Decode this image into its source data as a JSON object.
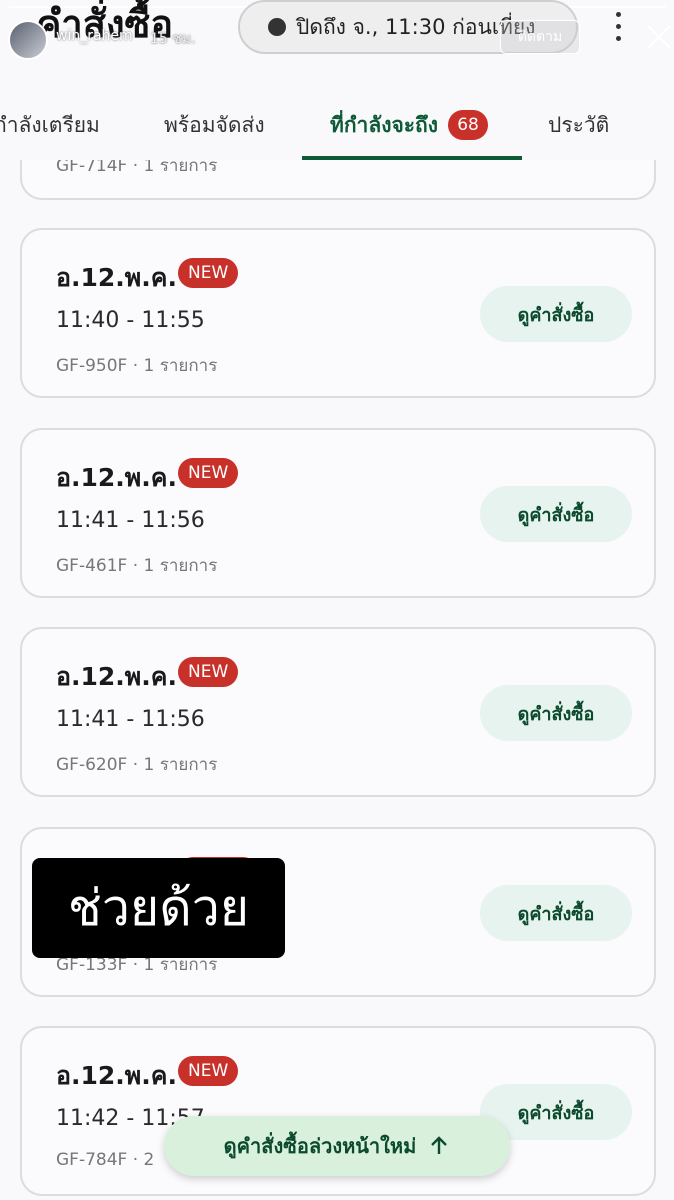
{
  "header": {
    "title": "คำสั่งซื้อ",
    "username": "win_rahem",
    "story_time": "15 ชม.",
    "follow_label": "ติดตาม",
    "close_status": "ปิดถึง จ., 11:30 ก่อนเที่ยง"
  },
  "tabs": [
    {
      "label": "กำลังเตรียม"
    },
    {
      "label": "พร้อมจัดส่ง"
    },
    {
      "label": "ที่กำลังจะถึง",
      "badge": "68",
      "active": true
    },
    {
      "label": "ประวัติ"
    }
  ],
  "orders": [
    {
      "id_line": "GF-714F · 1 รายการ"
    },
    {
      "date": "อ.12.พ.ค.",
      "badge": "NEW",
      "time": "11:40 - 11:55",
      "id_line": "GF-950F · 1 รายการ",
      "action": "ดูคำสั่งซื้อ"
    },
    {
      "date": "อ.12.พ.ค.",
      "badge": "NEW",
      "time": "11:41 - 11:56",
      "id_line": "GF-461F · 1 รายการ",
      "action": "ดูคำสั่งซื้อ"
    },
    {
      "date": "อ.12.พ.ค.",
      "badge": "NEW",
      "time": "11:41 - 11:56",
      "id_line": "GF-620F · 1 รายการ",
      "action": "ดูคำสั่งซื้อ"
    },
    {
      "date": "",
      "badge": "",
      "time": "",
      "id_line": "GF-133F · 1 รายการ",
      "action": "ดูคำสั่งซื้อ"
    },
    {
      "date": "อ.12.พ.ค.",
      "badge": "NEW",
      "time": "11:42 - 11:57",
      "id_line": "GF-784F · 2",
      "action": "ดูคำสั่งซื้อ"
    }
  ],
  "overlay_text": "ช่วยด้วย",
  "float_button": "ดูคำสั่งซื้อล่วงหน้าใหม่",
  "colors": {
    "brand_green": "#0c5a36",
    "badge_red": "#c8302a",
    "button_bg": "#e6f3ee",
    "float_bg": "#d9f0dd"
  }
}
